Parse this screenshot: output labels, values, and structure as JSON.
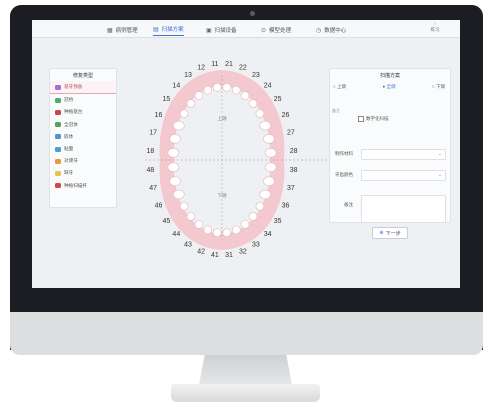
{
  "nav": {
    "items": [
      {
        "label": "病例管理",
        "icon": "▦"
      },
      {
        "label": "扫描方案",
        "icon": "▤"
      },
      {
        "label": "扫描设备",
        "icon": "▣"
      },
      {
        "label": "模型处理",
        "icon": "⊙"
      },
      {
        "label": "数据中心",
        "icon": "◷"
      }
    ],
    "active_index": 1,
    "user_label": "练习"
  },
  "sidebar": {
    "title": "修复类型",
    "items": [
      {
        "label": "基牙预备",
        "color": "#a56bd6"
      },
      {
        "label": "冠桥",
        "color": "#4caf6a"
      },
      {
        "label": "种植基台",
        "color": "#c44848"
      },
      {
        "label": "全冠体",
        "color": "#5aa05a"
      },
      {
        "label": "嵌体",
        "color": "#5a8fd0"
      },
      {
        "label": "贴面",
        "color": "#4a9fd0"
      },
      {
        "label": "对颌牙",
        "color": "#e89a3c"
      },
      {
        "label": "缺牙",
        "color": "#e8c44c"
      },
      {
        "label": "种植扫描杆",
        "color": "#d04848"
      }
    ],
    "selected_index": 0
  },
  "jaw": {
    "upper_label": "上颌",
    "lower_label": "下颌",
    "upper_teeth": [
      "18",
      "17",
      "16",
      "15",
      "14",
      "13",
      "12",
      "11",
      "21",
      "22",
      "23",
      "24",
      "25",
      "26",
      "27",
      "28"
    ],
    "lower_teeth": [
      "48",
      "47",
      "46",
      "45",
      "44",
      "43",
      "42",
      "41",
      "31",
      "32",
      "33",
      "34",
      "35",
      "36",
      "37",
      "38"
    ]
  },
  "panel": {
    "title": "扫描方案",
    "radio_options": [
      "上颌",
      "全颌",
      "下颌"
    ],
    "selected_radio": 1,
    "small_label": "备注",
    "checkbox_label": "数字化扫描",
    "material_label": "制作材料",
    "material_value": "",
    "color_label": "牙齿颜色",
    "color_value": "",
    "note_label": "备注",
    "next_button": "下一步"
  }
}
